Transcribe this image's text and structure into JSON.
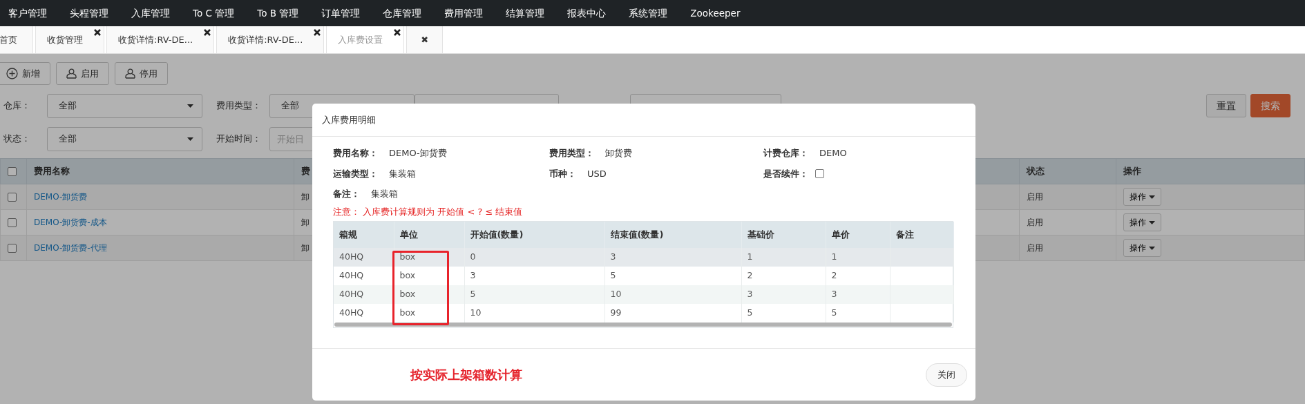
{
  "nav": {
    "items": [
      "客户管理",
      "头程管理",
      "入库管理",
      "To C 管理",
      "To B 管理",
      "订单管理",
      "仓库管理",
      "费用管理",
      "结算管理",
      "报表中心",
      "系统管理",
      "Zookeeper"
    ]
  },
  "tabs": [
    {
      "label": "首页",
      "closable": false,
      "selected": false
    },
    {
      "label": "收货管理",
      "closable": true,
      "selected": false
    },
    {
      "label": "收货详情:RV-DE...",
      "closable": true,
      "selected": false
    },
    {
      "label": "收货详情:RV-DE...",
      "closable": true,
      "selected": false
    },
    {
      "label": "入库费设置",
      "closable": true,
      "selected": true
    },
    {
      "label": "✖",
      "closable": false,
      "selected": false
    }
  ],
  "toolbar": [
    {
      "label": "新增"
    },
    {
      "label": "启用"
    },
    {
      "label": "停用"
    }
  ],
  "filters": {
    "row_1": [
      {
        "kind": "select",
        "label": "仓库：",
        "value": "全部"
      },
      {
        "kind": "select",
        "label": "费用类型：",
        "value": "全部"
      },
      {
        "kind": "select-covered"
      },
      {
        "kind": "input-covered"
      }
    ],
    "row_2": [
      {
        "kind": "select",
        "label": "状态：",
        "value": "全部"
      },
      {
        "kind": "date",
        "label": "开始时间：",
        "placeholder": "开始日"
      }
    ],
    "buttons": [
      {
        "label": "重置",
        "primary": false
      },
      {
        "label": "搜索",
        "primary": true
      }
    ]
  },
  "table": {
    "header_checked": false,
    "columns": [
      "费用名称",
      "费",
      "状态",
      "操作"
    ],
    "rows": [
      {
        "name": "DEMO-卸货费",
        "column_2": "卸",
        "status": "启用",
        "action": "操作",
        "checked": false
      },
      {
        "name": "DEMO-卸货费-成本",
        "column_2": "卸",
        "status": "启用",
        "action": "操作",
        "checked": false
      },
      {
        "name": "DEMO-卸货费-代理",
        "column_2": "卸",
        "status": "启用",
        "action": "操作",
        "checked": false
      }
    ]
  },
  "modal": {
    "title": "入库费用明细",
    "fields": [
      {
        "kind": "text",
        "label": "费用名称：",
        "value": "DEMO-卸货费"
      },
      {
        "kind": "text",
        "label": "费用类型：",
        "value": "卸货费"
      },
      {
        "kind": "text",
        "label": "计费仓库：",
        "value": "DEMO"
      },
      {
        "kind": "text",
        "label": "运输类型：",
        "value": "集装箱"
      },
      {
        "kind": "text",
        "label": "币种：",
        "value": "USD"
      },
      {
        "kind": "checkbox",
        "label": "是否续件：",
        "checked": false
      },
      {
        "kind": "text",
        "label": "备注：",
        "value": "集装箱"
      }
    ],
    "notice": "注意：  入库费计算规则为 开始值 < ? ≤ 结束值",
    "columns": [
      "箱规",
      "单位",
      "开始值(数量)",
      "结束值(数量)",
      "基础价",
      "单价",
      "备注"
    ],
    "rows": [
      [
        "40HQ",
        "box",
        "0",
        "3",
        "1",
        "1",
        ""
      ],
      [
        "40HQ",
        "box",
        "3",
        "5",
        "2",
        "2",
        ""
      ],
      [
        "40HQ",
        "box",
        "5",
        "10",
        "3",
        "3",
        ""
      ],
      [
        "40HQ",
        "box",
        "10",
        "99",
        "5",
        "5",
        ""
      ]
    ],
    "annotation": "按实际上架箱数计算",
    "close_button": "关闭"
  }
}
